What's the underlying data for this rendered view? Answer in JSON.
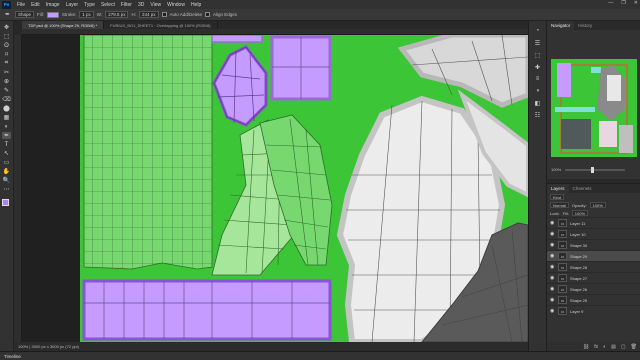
{
  "menubar": {
    "logo": "Ps",
    "items": [
      "File",
      "Edit",
      "Image",
      "Layer",
      "Type",
      "Select",
      "Filter",
      "3D",
      "View",
      "Window",
      "Help"
    ],
    "window_controls": [
      "—",
      "❐",
      "✕"
    ]
  },
  "options": {
    "mode": "Shape",
    "fill_label": "Fill:",
    "stroke_label": "Stroke:",
    "stroke_width": "1 px",
    "w_label": "W:",
    "w_value": "279.5 px",
    "h_label": "H:",
    "h_value": "244 px",
    "auto_add_delete": "Auto Add/Delete",
    "align_edges": "Align Edges",
    "fill_color": "#c59bff"
  },
  "tabs": [
    {
      "label": "TDF.psd @ 100% (Shape 29, RGB/8) *",
      "active": true
    },
    {
      "label": "FURIUS_BG1_SHEET1 · Overlapping @ 100% (RGB/8)",
      "active": false
    }
  ],
  "toolbar": {
    "tools": [
      "✥",
      "⬚",
      "ʘ",
      "⌑",
      "⌗",
      "✂",
      "⊕",
      "✎",
      "⌫",
      "⬤",
      "▦",
      "◐",
      "✒",
      "T",
      "↖",
      "▭",
      "✋",
      "🔍",
      "⋯"
    ]
  },
  "status": {
    "doc_size": "100%   |  3000 px x 3000 px (72 ppi)"
  },
  "timeline": {
    "label": "Timeline"
  },
  "right_icons": [
    "◔",
    "☰",
    "⬚",
    "✚",
    "≡",
    "◑",
    "◧",
    "☷"
  ],
  "navigator": {
    "tabs": [
      "Navigator",
      "History"
    ],
    "zoom": "100%"
  },
  "layers": {
    "tabs": [
      "Layers",
      "Channels"
    ],
    "kind": "Kind",
    "blend": "Normal",
    "opacity_label": "Opacity:",
    "opacity": "100%",
    "lock_label": "Lock:",
    "fill_label": "Fill:",
    "fill": "100%",
    "items": [
      {
        "name": "Layer 11",
        "selected": false,
        "thumb": "▭"
      },
      {
        "name": "Layer 10",
        "selected": false,
        "thumb": "▭"
      },
      {
        "name": "Shape 30",
        "selected": false,
        "thumb": "▭"
      },
      {
        "name": "Shape 29",
        "selected": true,
        "thumb": "▭"
      },
      {
        "name": "Shape 28",
        "selected": false,
        "thumb": "▭"
      },
      {
        "name": "Shape 27",
        "selected": false,
        "thumb": "▭"
      },
      {
        "name": "Shape 26",
        "selected": false,
        "thumb": "▭"
      },
      {
        "name": "Shape 25",
        "selected": false,
        "thumb": "▭"
      },
      {
        "name": "Layer 9",
        "selected": false,
        "thumb": "▭"
      }
    ],
    "footer_icons": [
      "⛓",
      "fx",
      "◐",
      "▤",
      "▢",
      "🗑"
    ]
  },
  "colors": {
    "canvas_green": "#3cc536",
    "uv_green": "#78d870",
    "uv_purple": "#c59bff",
    "uv_white": "#ececec",
    "dark_gray": "#5a5a5a"
  }
}
